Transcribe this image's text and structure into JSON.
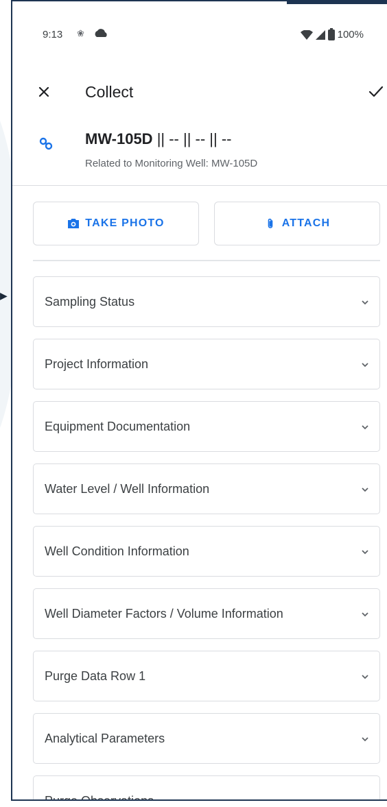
{
  "status_bar": {
    "time": "9:13",
    "notif_icon": "notification-icon",
    "battery": "100%"
  },
  "toolbar": {
    "title": "Collect",
    "close_icon": "close-icon",
    "confirm_icon": "check-icon"
  },
  "record": {
    "id": "MW-105D",
    "suffix": " || -- || -- || --",
    "related": "Related to Monitoring Well: MW-105D",
    "link_icon": "link-icon"
  },
  "actions": {
    "take_photo": "TAKE PHOTO",
    "attach": "ATTACH"
  },
  "sections": [
    {
      "label": "Sampling Status"
    },
    {
      "label": "Project Information"
    },
    {
      "label": "Equipment Documentation"
    },
    {
      "label": "Water Level / Well Information"
    },
    {
      "label": "Well Condition Information"
    },
    {
      "label": "Well Diameter Factors / Volume Information"
    },
    {
      "label": "Purge Data Row 1"
    },
    {
      "label": "Analytical Parameters"
    },
    {
      "label": "Purge Observations"
    }
  ],
  "colors": {
    "accent": "#1a73e8",
    "frame": "#1d3452",
    "border": "#dadce0"
  }
}
